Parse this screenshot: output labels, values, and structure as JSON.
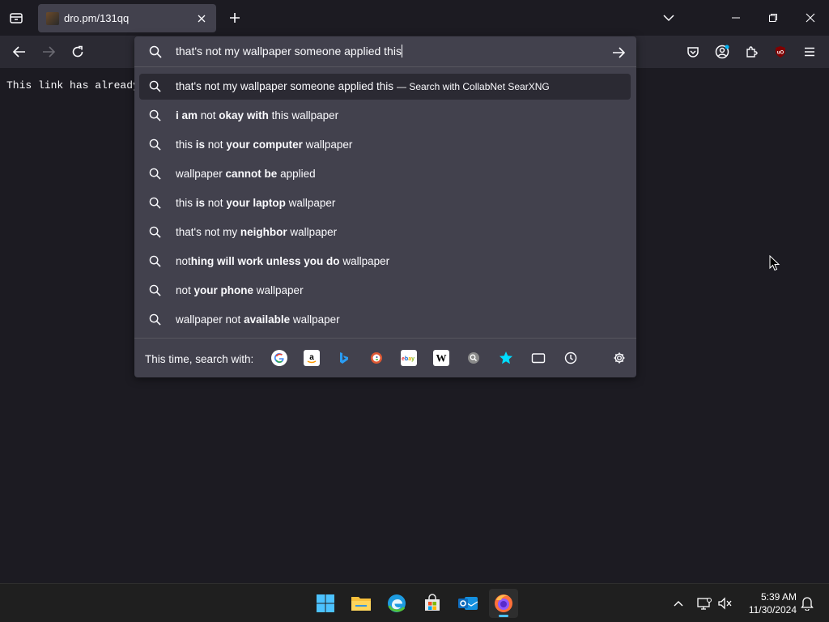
{
  "tab": {
    "title": "dro.pm/131qq"
  },
  "page": {
    "text": "This link has already b"
  },
  "urlbar": {
    "value": "that's not my wallpaper someone applied this",
    "suggestions": [
      {
        "parts": [
          {
            "t": "that's not my wallpaper someone applied this",
            "b": false
          }
        ],
        "action": "— Search with CollabNet SearXNG"
      },
      {
        "parts": [
          {
            "t": "i am",
            "b": true
          },
          {
            "t": " not ",
            "b": false
          },
          {
            "t": "okay with",
            "b": true
          },
          {
            "t": " this wallpaper",
            "b": false
          }
        ]
      },
      {
        "parts": [
          {
            "t": "this ",
            "b": false
          },
          {
            "t": "is",
            "b": true
          },
          {
            "t": " not ",
            "b": false
          },
          {
            "t": "your computer",
            "b": true
          },
          {
            "t": " wallpaper",
            "b": false
          }
        ]
      },
      {
        "parts": [
          {
            "t": "wallpaper ",
            "b": false
          },
          {
            "t": "cannot be",
            "b": true
          },
          {
            "t": " applied",
            "b": false
          }
        ]
      },
      {
        "parts": [
          {
            "t": "this ",
            "b": false
          },
          {
            "t": "is",
            "b": true
          },
          {
            "t": " not ",
            "b": false
          },
          {
            "t": "your laptop",
            "b": true
          },
          {
            "t": " wallpaper",
            "b": false
          }
        ]
      },
      {
        "parts": [
          {
            "t": "that's not my ",
            "b": false
          },
          {
            "t": "neighbor",
            "b": true
          },
          {
            "t": " wallpaper",
            "b": false
          }
        ]
      },
      {
        "parts": [
          {
            "t": "not",
            "b": false
          },
          {
            "t": "hing will work unless you do",
            "b": true
          },
          {
            "t": " wallpaper",
            "b": false
          }
        ]
      },
      {
        "parts": [
          {
            "t": "not ",
            "b": false
          },
          {
            "t": "your phone",
            "b": true
          },
          {
            "t": " wallpaper",
            "b": false
          }
        ]
      },
      {
        "parts": [
          {
            "t": "wallpaper not ",
            "b": false
          },
          {
            "t": "available",
            "b": true
          },
          {
            "t": " wallpaper",
            "b": false
          }
        ]
      }
    ],
    "oneoff_label": "This time, search with:",
    "engines": [
      "google",
      "amazon",
      "bing",
      "duckduckgo",
      "ebay",
      "wikipedia",
      "searxng",
      "bookmarks",
      "tabs",
      "history"
    ]
  },
  "taskbar": {
    "time": "5:39 AM",
    "date": "11/30/2024"
  },
  "colors": {
    "accent": "#4cc2ff",
    "panel": "#42414d",
    "toolbar": "#2b2a33",
    "page": "#1c1b22"
  }
}
